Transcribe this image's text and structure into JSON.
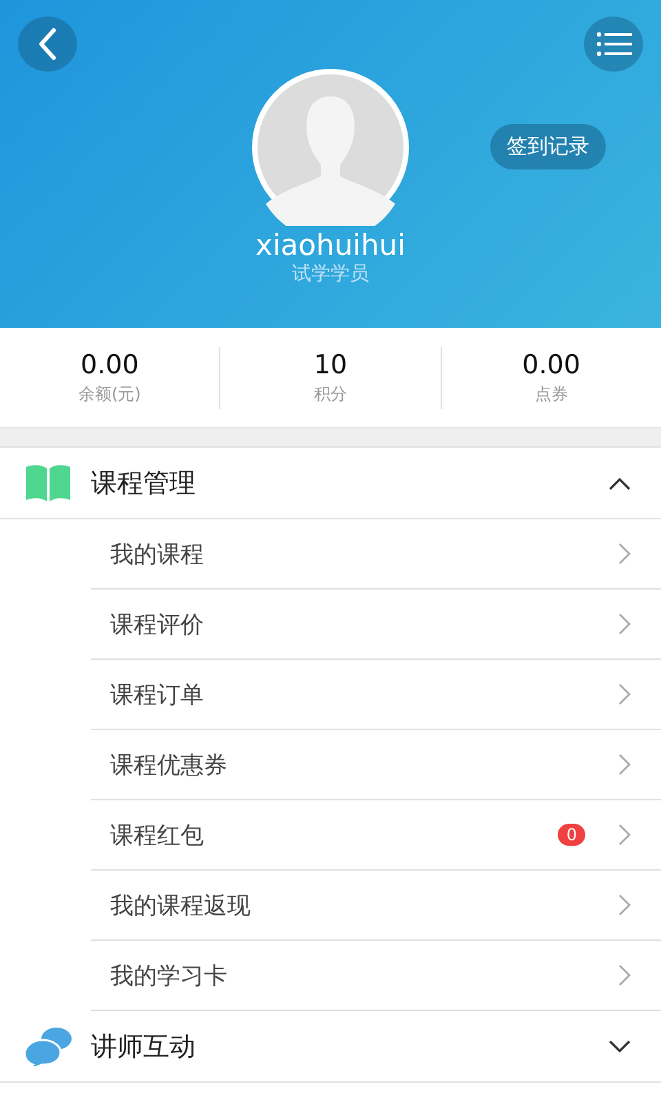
{
  "header": {
    "username": "xiaohuihui",
    "role": "试学学员",
    "checkin_button": "签到记录"
  },
  "stats": [
    {
      "value": "0.00",
      "label": "余额(元)"
    },
    {
      "value": "10",
      "label": "积分"
    },
    {
      "value": "0.00",
      "label": "点券"
    }
  ],
  "sections": [
    {
      "title": "课程管理",
      "kind": "book",
      "expanded": true,
      "items": [
        {
          "label": "我的课程"
        },
        {
          "label": "课程评价"
        },
        {
          "label": "课程订单"
        },
        {
          "label": "课程优惠券"
        },
        {
          "label": "课程红包",
          "badge": "0"
        },
        {
          "label": "我的课程返现"
        },
        {
          "label": "我的学习卡"
        }
      ]
    },
    {
      "title": "讲师互动",
      "kind": "chat",
      "expanded": false
    }
  ]
}
